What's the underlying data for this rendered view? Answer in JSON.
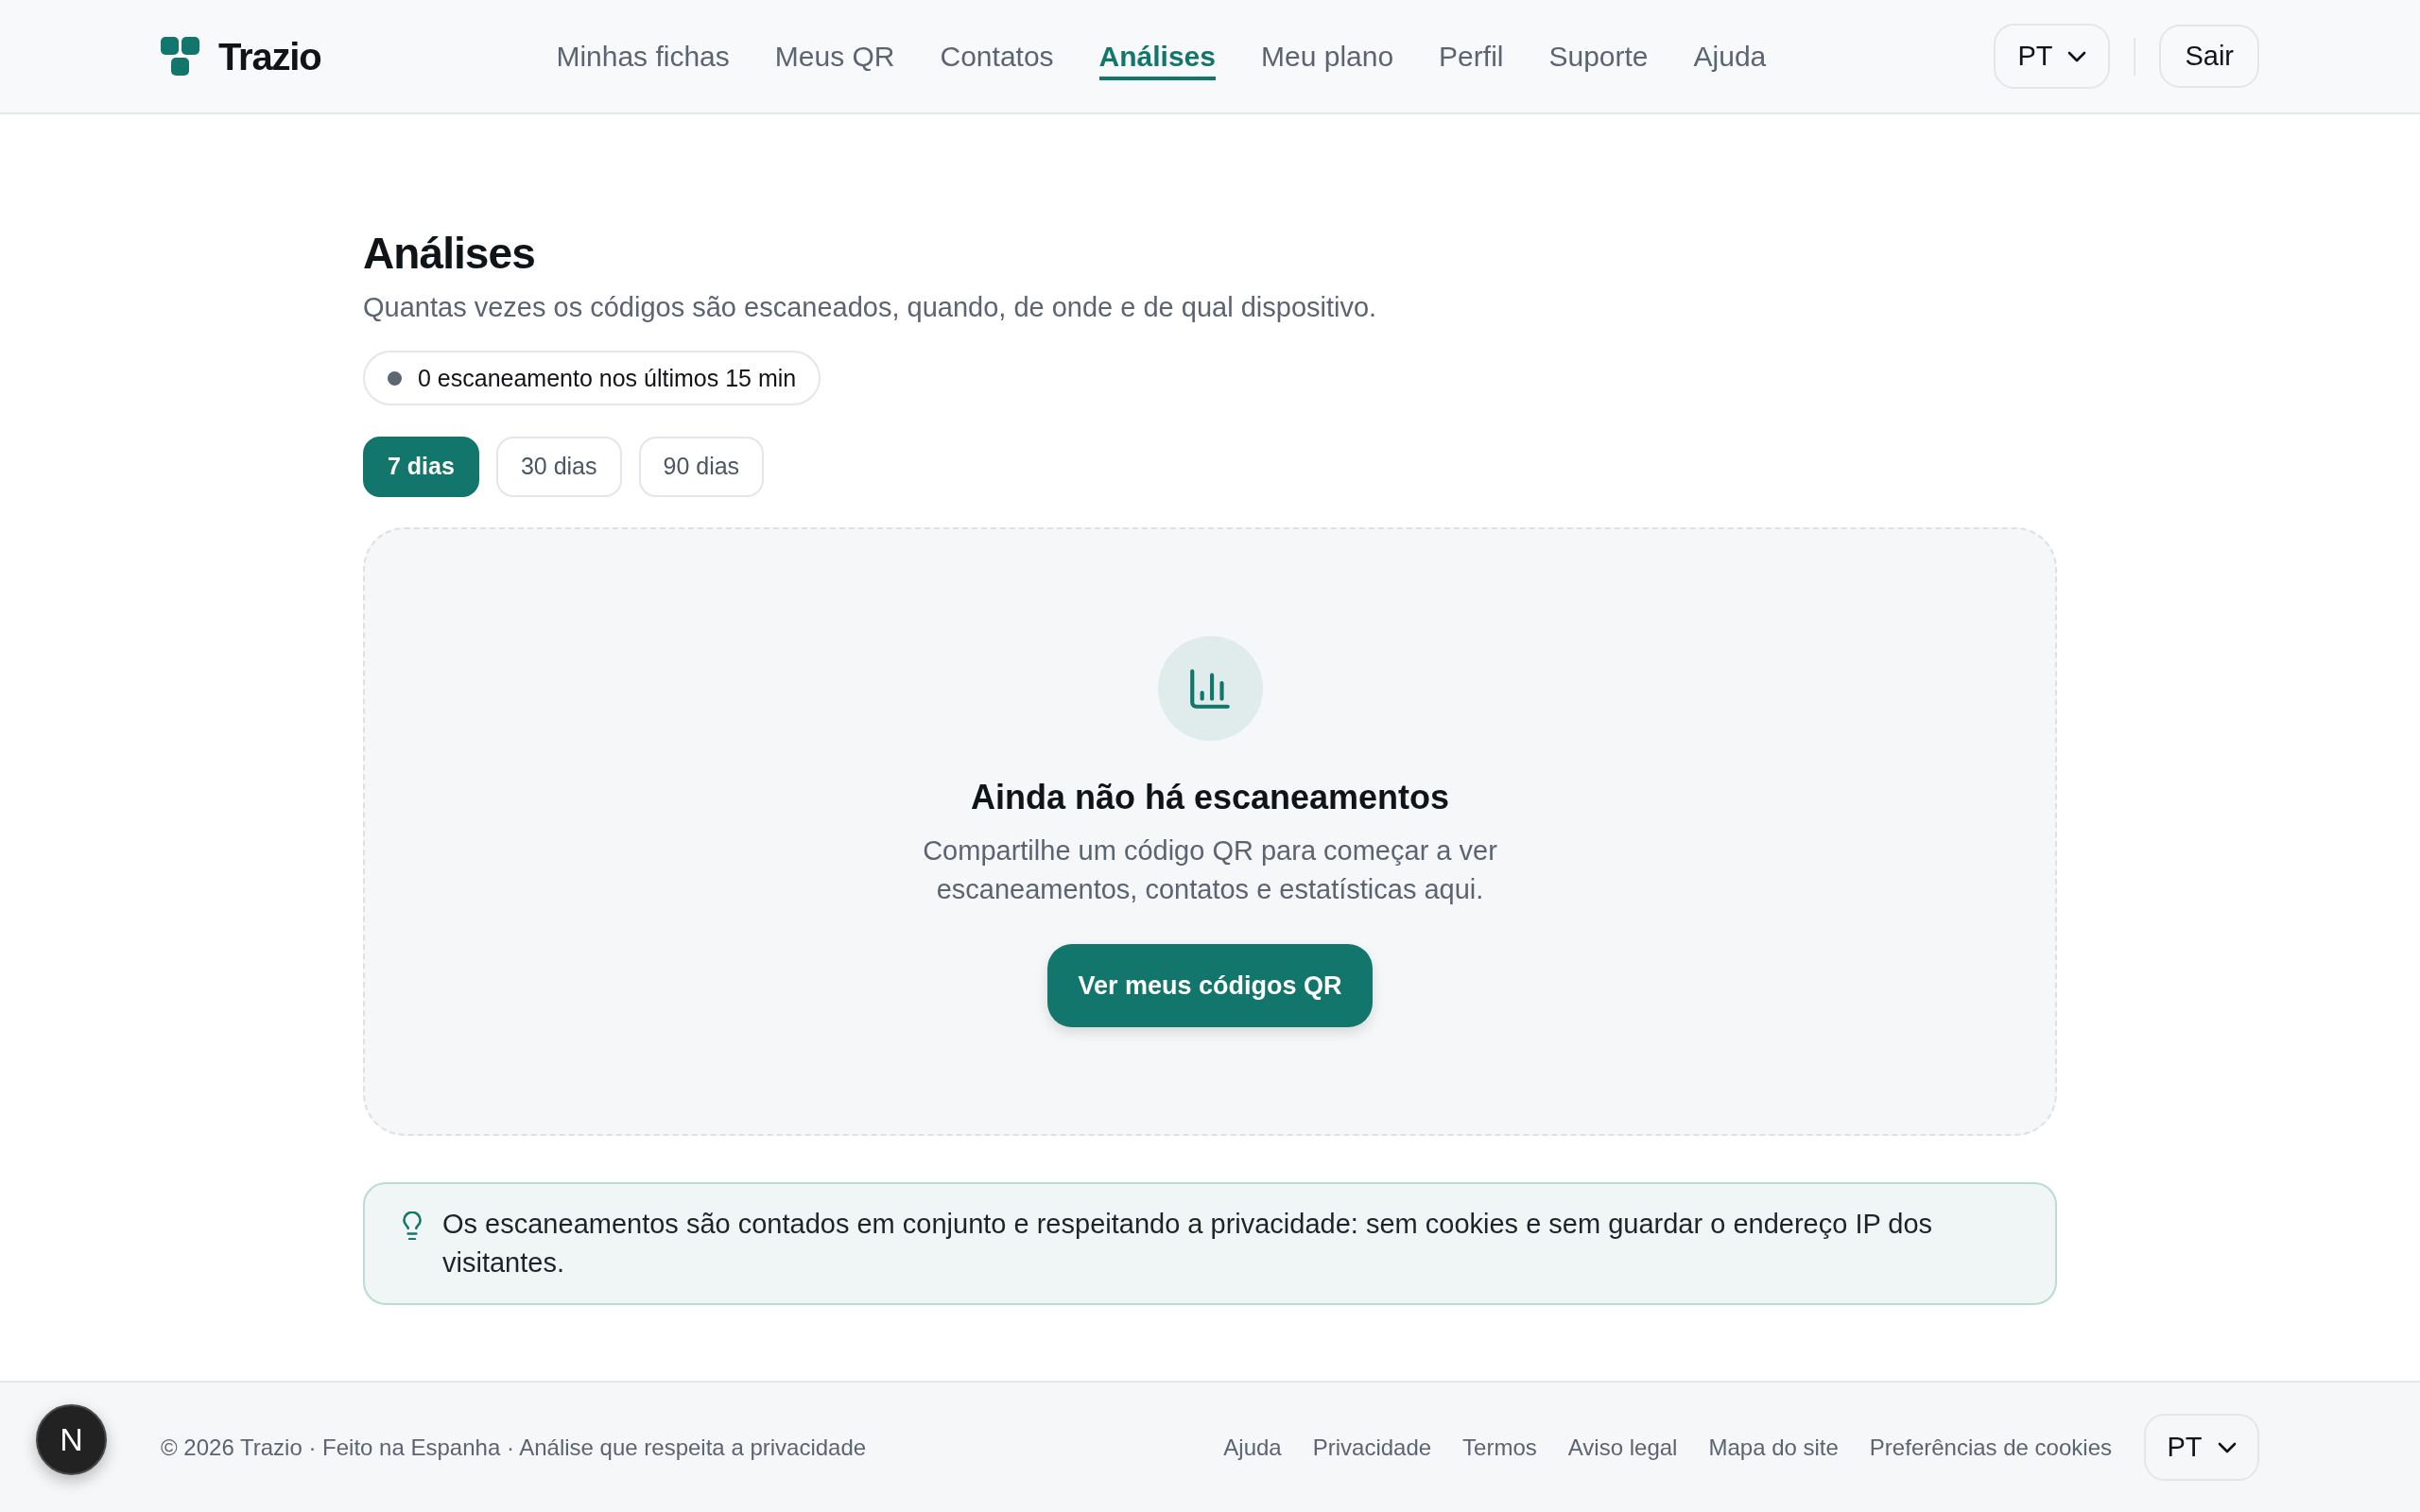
{
  "header": {
    "logo_text": "Trazio",
    "nav": [
      {
        "label": "Minhas fichas",
        "selected": false
      },
      {
        "label": "Meus QR",
        "selected": false
      },
      {
        "label": "Contatos",
        "selected": false
      },
      {
        "label": "Análises",
        "selected": true
      },
      {
        "label": "Meu plano",
        "selected": false
      },
      {
        "label": "Perfil",
        "selected": false
      },
      {
        "label": "Suporte",
        "selected": false
      },
      {
        "label": "Ajuda",
        "selected": false
      }
    ],
    "language": "PT",
    "logout": "Sair"
  },
  "page": {
    "title": "Análises",
    "subtitle": "Quantas vezes os códigos são escaneados, quando, de onde e de qual dispositivo.",
    "live_status": "0 escaneamento nos últimos 15 min",
    "ranges": [
      {
        "label": "7 dias",
        "selected": true
      },
      {
        "label": "30 dias",
        "selected": false
      },
      {
        "label": "90 dias",
        "selected": false
      }
    ]
  },
  "empty_state": {
    "title": "Ainda não há escaneamentos",
    "description": "Compartilhe um código QR para começar a ver escaneamentos, contatos e estatísticas aqui.",
    "button": "Ver meus códigos QR"
  },
  "notice": {
    "text": "Os escaneamentos são contados em conjunto e respeitando a privacidade: sem cookies e sem guardar o endereço IP dos visitantes."
  },
  "footer": {
    "copyright": "© 2026 Trazio · Feito na Espanha · Análise que respeita a privacidade",
    "links": [
      "Ajuda",
      "Privacidade",
      "Termos",
      "Aviso legal",
      "Mapa do site",
      "Preferências de cookies"
    ],
    "language": "PT"
  },
  "dev_badge": {
    "label": "N"
  }
}
